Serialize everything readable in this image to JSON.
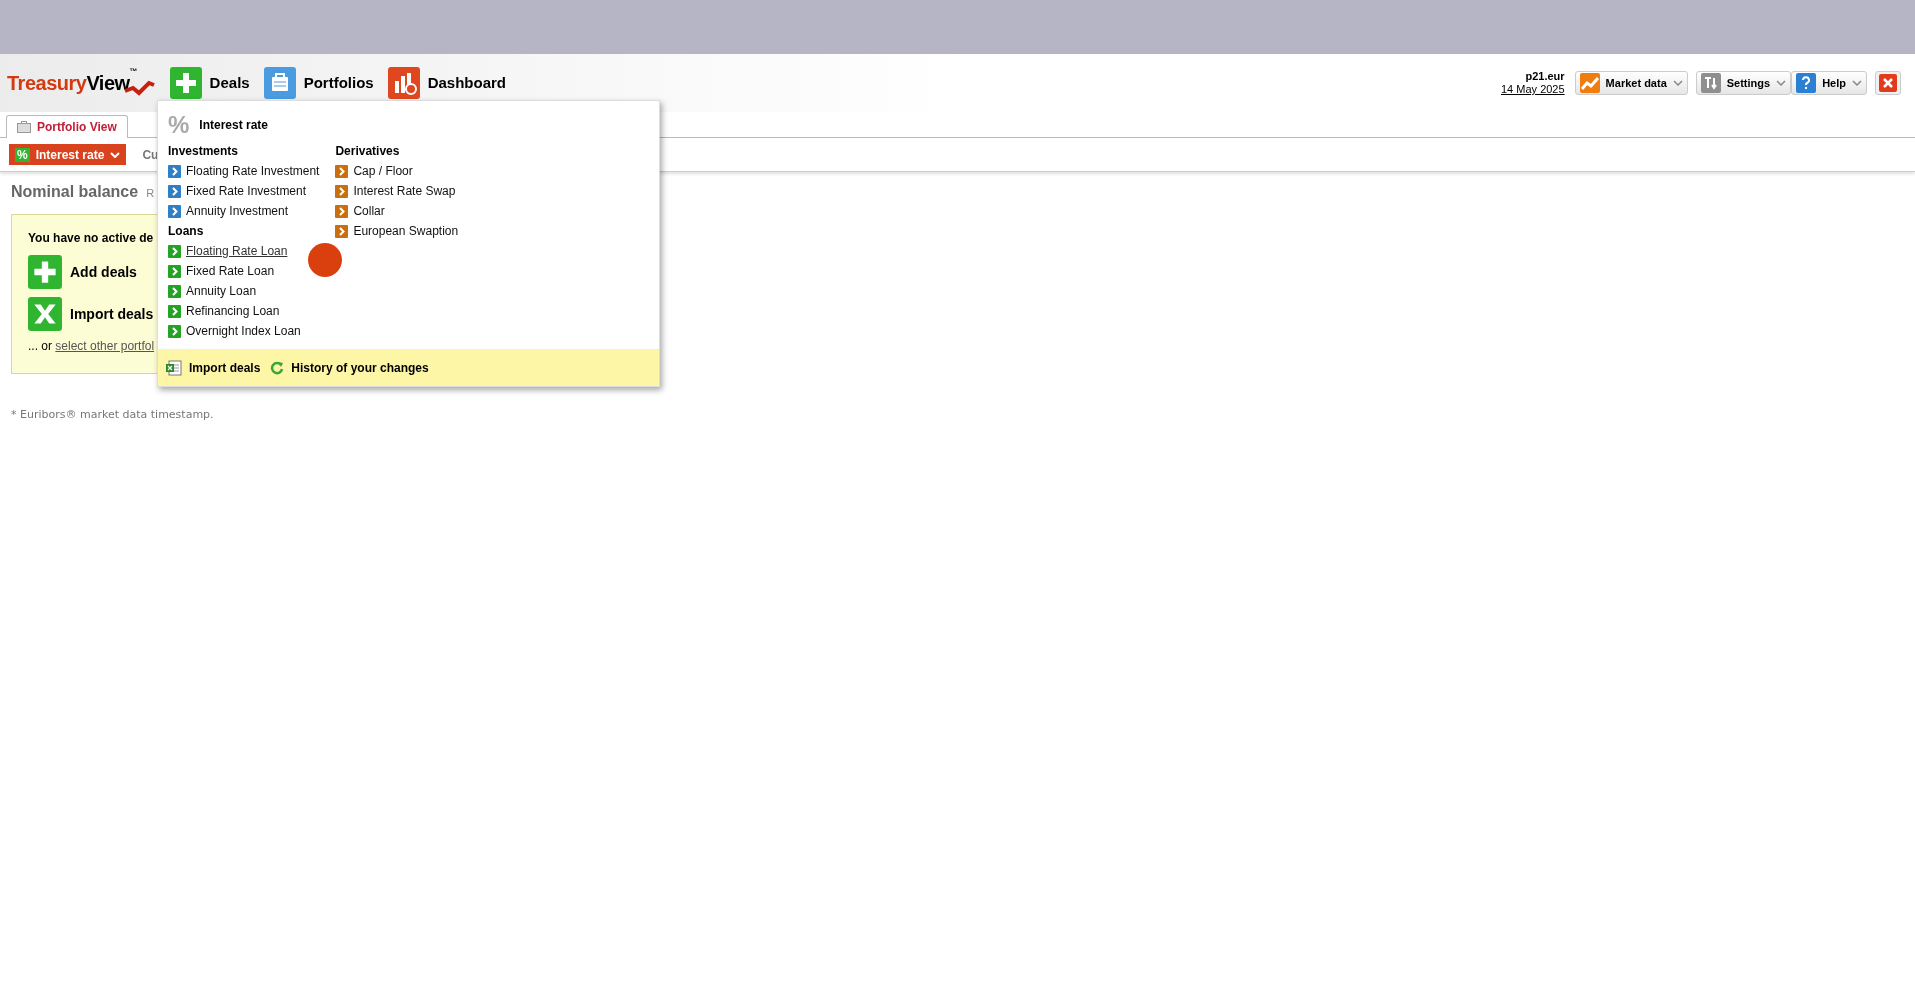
{
  "logo": {
    "name": "Treasury",
    "accent": "View",
    "mark": "™"
  },
  "nav": [
    {
      "label": "Deals",
      "kind": "deals"
    },
    {
      "label": "Portfolios",
      "kind": "portfolios"
    },
    {
      "label": "Dashboard",
      "kind": "dashboard"
    }
  ],
  "account": {
    "name": "p21.eur",
    "date": "14 May 2025"
  },
  "tools": [
    {
      "label": "Market data",
      "kind": "market"
    },
    {
      "label": "Settings",
      "kind": "settings"
    },
    {
      "label": "Help",
      "kind": "help"
    }
  ],
  "tabs": [
    {
      "label": "Portfolio View",
      "selected": true
    }
  ],
  "toolbar": {
    "category": {
      "glyph": "%",
      "label": "Interest rate"
    },
    "next_label": "Cu"
  },
  "main": {
    "title": "Nominal balance",
    "subtitle": "R",
    "notice": {
      "message": "You have no active de",
      "actions": [
        {
          "label": "Add deals",
          "kind": "add"
        },
        {
          "label": "Import deals",
          "kind": "import"
        }
      ],
      "prefix": "... or ",
      "link": "select other portfol"
    },
    "footnote": "* Euribors® market data timestamp."
  },
  "menu": {
    "header": {
      "glyph": "%",
      "title": "Interest rate"
    },
    "columns": [
      [
        {
          "heading": "Investments",
          "color": "#2f7fc8",
          "items": [
            {
              "label": "Floating Rate Investment",
              "hovered": false
            },
            {
              "label": "Fixed Rate Investment",
              "hovered": false
            },
            {
              "label": "Annuity Investment",
              "hovered": false
            }
          ]
        },
        {
          "heading": "Loans",
          "color": "#22a422",
          "items": [
            {
              "label": "Floating Rate Loan",
              "hovered": true
            },
            {
              "label": "Fixed Rate Loan",
              "hovered": false
            },
            {
              "label": "Annuity Loan",
              "hovered": false
            },
            {
              "label": "Refinancing Loan",
              "hovered": false
            },
            {
              "label": "Overnight Index Loan",
              "hovered": false
            }
          ]
        }
      ],
      [
        {
          "heading": "Derivatives",
          "color": "#c8700f",
          "items": [
            {
              "label": "Cap / Floor",
              "hovered": false
            },
            {
              "label": "Interest Rate Swap",
              "hovered": false
            },
            {
              "label": "Collar",
              "hovered": false
            },
            {
              "label": "European Swaption",
              "hovered": false
            }
          ]
        }
      ]
    ],
    "footer": [
      {
        "label": "Import deals",
        "kind": "import"
      },
      {
        "label": "History of your changes",
        "kind": "history"
      }
    ]
  }
}
